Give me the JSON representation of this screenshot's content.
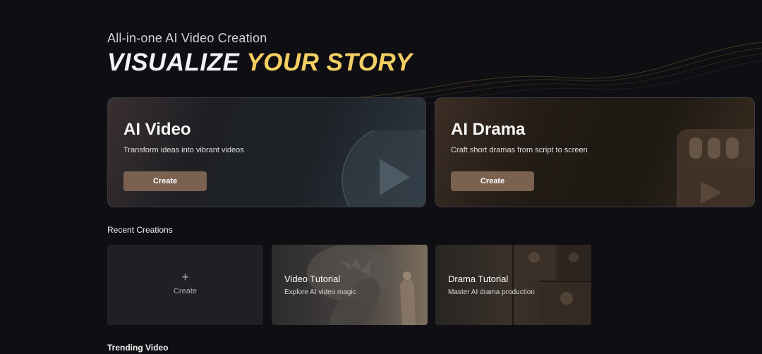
{
  "hero": {
    "subtitle": "All-in-one AI Video Creation",
    "headline_part1": "VISUALIZE",
    "headline_part2": "YOUR STORY"
  },
  "cards": {
    "video": {
      "title": "AI Video",
      "description": "Transform ideas into vibrant videos",
      "button": "Create",
      "icon": "play-icon"
    },
    "drama": {
      "title": "AI Drama",
      "description": "Craft short dramas from script to screen",
      "button": "Create",
      "icon": "clapperboard-icon"
    }
  },
  "recent": {
    "title": "Recent Creations",
    "create_tile": {
      "plus": "+",
      "label": "Create"
    },
    "tiles": [
      {
        "title": "Video Tutorial",
        "description": "Explore AI video magic"
      },
      {
        "title": "Drama Tutorial",
        "description": "Master AI drama production"
      }
    ]
  },
  "trending": {
    "title": "Trending Video"
  },
  "colors": {
    "background": "#0f0e13",
    "accent_gold": "#f3cf63",
    "button": "#7a6150"
  }
}
